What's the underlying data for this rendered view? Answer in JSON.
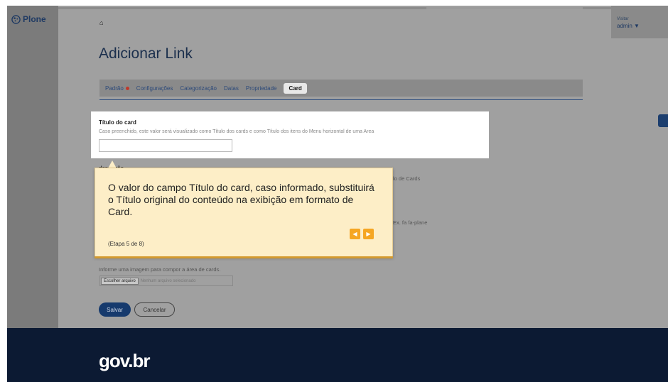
{
  "brand": {
    "logo_text": "Plone"
  },
  "user": {
    "label": "Visitar",
    "name": "admin ▼"
  },
  "breadcrumb": {
    "home_glyph": "⌂"
  },
  "page": {
    "title": "Adicionar Link"
  },
  "tabs": [
    {
      "label": "Padrão",
      "required": true,
      "active": false
    },
    {
      "label": "Configurações",
      "active": false
    },
    {
      "label": "Categorização",
      "active": false
    },
    {
      "label": "Datas",
      "active": false
    },
    {
      "label": "Propriedade",
      "active": false
    },
    {
      "label": "Card",
      "active": true
    }
  ],
  "field_card_title": {
    "label": "Título do card",
    "help": "Caso preenchido, este valor será visualizado como Título dos cards e como Título dos itens do Menu horizontal de uma Area",
    "value": ""
  },
  "background_fields": {
    "description_label": "descrição",
    "cards_fragment": "lo de Cards",
    "icon_fragment": "Ex. fa fa-plane",
    "image_help": "Informe uma imagem para compor a área de cards.",
    "choose_file": "Escolher arquivo",
    "no_file": "Nenhum arquivo selecionado"
  },
  "actions": {
    "save": "Salvar",
    "cancel": "Cancelar"
  },
  "footer": {
    "logo": "gov.br"
  },
  "tour": {
    "text": "O valor do campo Título do card, caso informado, substituirá o Título original do conteúdo na exibição em formato de Card.",
    "step": "(Etapa 5 de 8)",
    "prev_glyph": "◀",
    "next_glyph": "▶"
  }
}
